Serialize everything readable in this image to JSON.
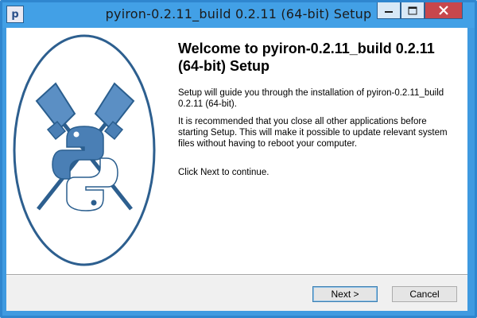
{
  "window": {
    "title": "pyiron-0.2.11_build 0.2.11 (64-bit) Setup",
    "app_icon_letter": "p",
    "controls": {
      "minimize_icon": "minimize-icon",
      "maximize_icon": "maximize-icon",
      "close_icon": "close-icon"
    }
  },
  "colors": {
    "titlebar": "#42a0e6",
    "close_button": "#c7474c",
    "logo_blue": "#4a7fb5",
    "logo_yellow": "#ffd43b",
    "logo_stroke": "#2a5e8e"
  },
  "banner": {
    "logo": "pyiron-logo"
  },
  "content": {
    "heading": "Welcome to pyiron-0.2.11_build 0.2.11 (64-bit) Setup",
    "paragraph1": "Setup will guide you through the installation of pyiron-0.2.11_build 0.2.11 (64-bit).",
    "paragraph2": "It is recommended that you close all other applications before starting Setup. This will make it possible to update relevant system files without having to reboot your computer.",
    "paragraph3": "Click Next to continue."
  },
  "buttons": {
    "next": "Next >",
    "cancel": "Cancel"
  }
}
